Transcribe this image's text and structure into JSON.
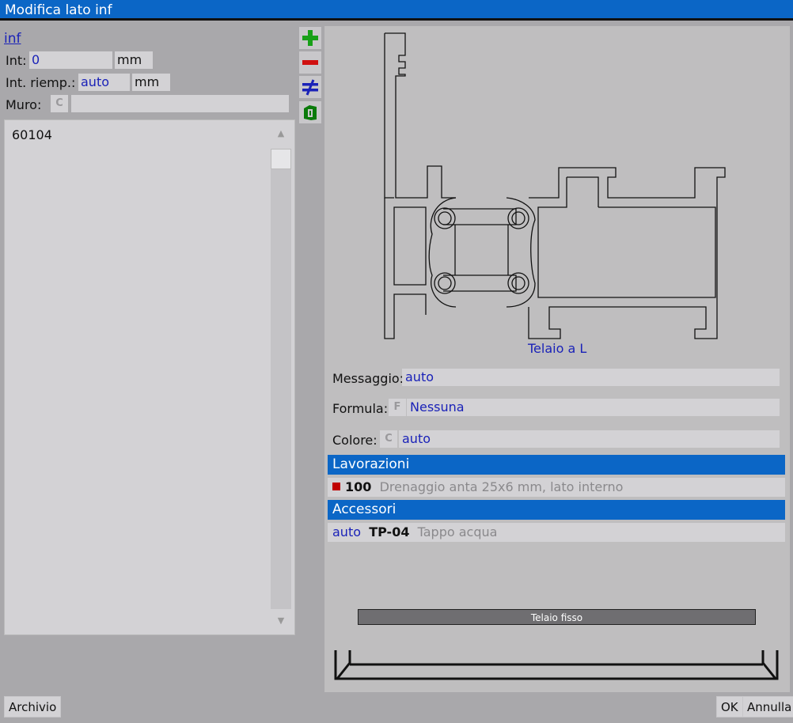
{
  "window": {
    "title": "Modifica lato inf"
  },
  "left": {
    "title": "inf",
    "int_label": "Int:",
    "int_value": "0",
    "int_unit": "mm",
    "riemp_label": "Int. riemp.:",
    "riemp_value": "auto",
    "riemp_unit": "mm",
    "muro_label": "Muro:",
    "muro_badge": "C",
    "muro_value": "",
    "list_items": [
      "60104"
    ]
  },
  "toolbar": {
    "icons": [
      "add-icon",
      "remove-icon",
      "not-equal-icon",
      "profile-icon"
    ],
    "colors": {
      "add": "#18a018",
      "remove": "#d01010",
      "not_equal": "#1a22b8",
      "profile": "#0a7a0a"
    }
  },
  "profile": {
    "caption": "Telaio a L"
  },
  "props": {
    "messaggio_label": "Messaggio:",
    "messaggio_value": "auto",
    "formula_label": "Formula:",
    "formula_badge": "F",
    "formula_value": "Nessuna",
    "colore_label": "Colore:",
    "colore_badge": "C",
    "colore_value": "auto"
  },
  "lavorazioni": {
    "header": "Lavorazioni",
    "rows": [
      {
        "code": "100",
        "desc": "Drenaggio anta 25x6 mm, lato interno"
      }
    ]
  },
  "accessori": {
    "header": "Accessori",
    "rows": [
      {
        "qty": "auto",
        "code": "TP-04",
        "desc": "Tappo acqua"
      }
    ]
  },
  "frame": {
    "label": "Telaio fisso"
  },
  "buttons": {
    "archivio": "Archivio",
    "ok": "OK",
    "annulla": "Annulla"
  },
  "colors": {
    "titlebar": "#0b66c6",
    "accent_text": "#1a22b8",
    "background": "#a9a8ab"
  }
}
